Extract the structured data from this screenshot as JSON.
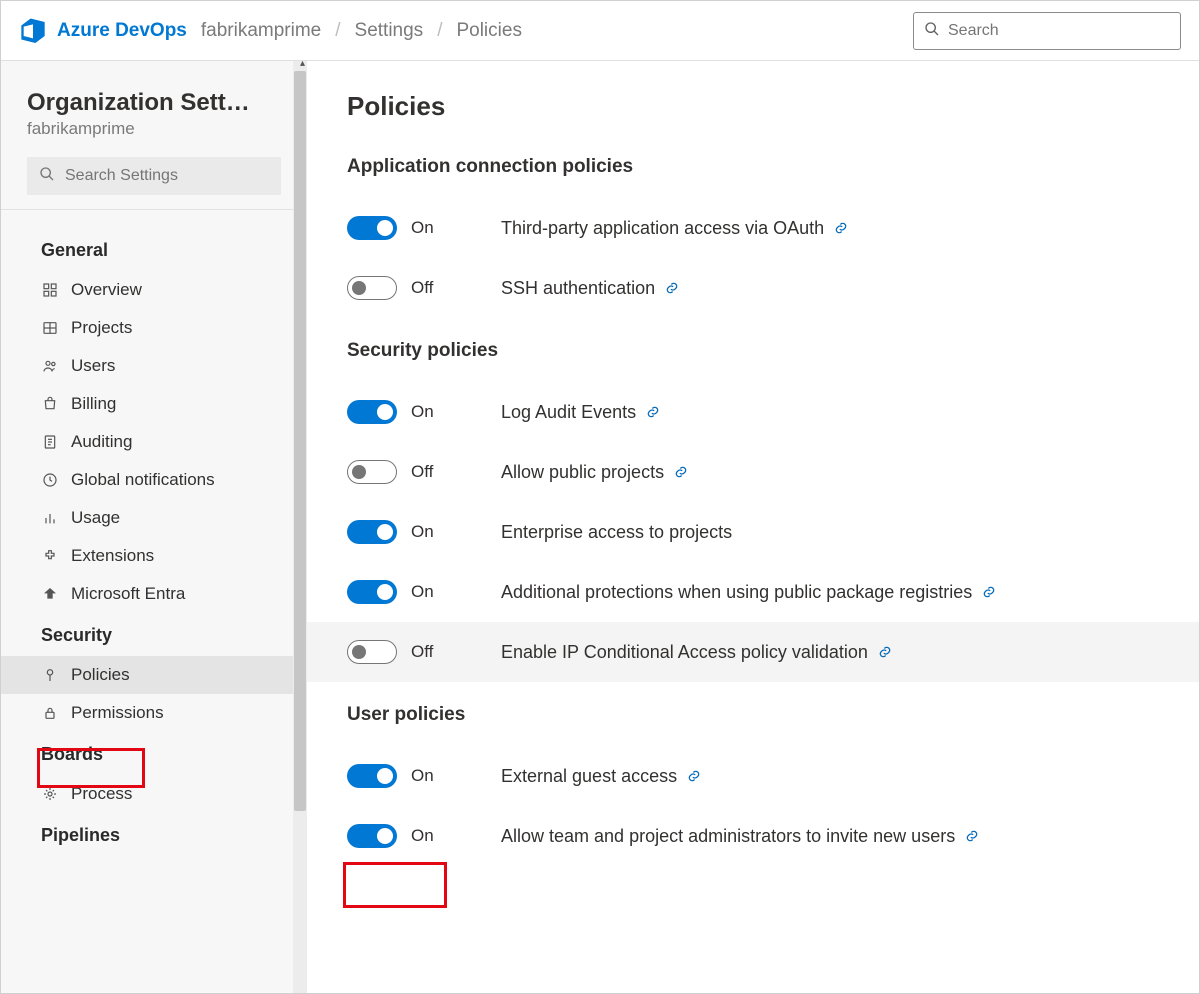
{
  "header": {
    "brand": "Azure DevOps",
    "search_placeholder": "Search"
  },
  "breadcrumb": {
    "items": [
      "fabrikamprime",
      "Settings",
      "Policies"
    ]
  },
  "sidebar": {
    "title": "Organization Settin...",
    "subtitle": "fabrikamprime",
    "search_placeholder": "Search Settings",
    "groups": [
      {
        "label": "General",
        "items": [
          {
            "icon": "overview",
            "label": "Overview"
          },
          {
            "icon": "projects",
            "label": "Projects"
          },
          {
            "icon": "users",
            "label": "Users"
          },
          {
            "icon": "billing",
            "label": "Billing"
          },
          {
            "icon": "auditing",
            "label": "Auditing"
          },
          {
            "icon": "notifications",
            "label": "Global notifications"
          },
          {
            "icon": "usage",
            "label": "Usage"
          },
          {
            "icon": "extensions",
            "label": "Extensions"
          },
          {
            "icon": "entra",
            "label": "Microsoft Entra"
          }
        ]
      },
      {
        "label": "Security",
        "items": [
          {
            "icon": "policies",
            "label": "Policies",
            "active": true
          },
          {
            "icon": "permissions",
            "label": "Permissions"
          }
        ]
      },
      {
        "label": "Boards",
        "items": [
          {
            "icon": "process",
            "label": "Process"
          }
        ]
      },
      {
        "label": "Pipelines",
        "items": []
      }
    ]
  },
  "main": {
    "title": "Policies",
    "sections": [
      {
        "title": "Application connection policies",
        "policies": [
          {
            "state_label": "On",
            "on": true,
            "label": "Third-party application access via OAuth",
            "has_link": true
          },
          {
            "state_label": "Off",
            "on": false,
            "label": "SSH authentication",
            "has_link": true
          }
        ]
      },
      {
        "title": "Security policies",
        "policies": [
          {
            "state_label": "On",
            "on": true,
            "label": "Log Audit Events",
            "has_link": true
          },
          {
            "state_label": "Off",
            "on": false,
            "label": "Allow public projects",
            "has_link": true
          },
          {
            "state_label": "On",
            "on": true,
            "label": "Enterprise access to projects",
            "has_link": false
          },
          {
            "state_label": "On",
            "on": true,
            "label": "Additional protections when using public package registries",
            "has_link": true
          },
          {
            "state_label": "Off",
            "on": false,
            "label": "Enable IP Conditional Access policy validation",
            "has_link": true,
            "hover": true
          }
        ]
      },
      {
        "title": "User policies",
        "policies": [
          {
            "state_label": "On",
            "on": true,
            "label": "External guest access",
            "has_link": true,
            "highlighted": true
          },
          {
            "state_label": "On",
            "on": true,
            "label": "Allow team and project administrators to invite new users",
            "has_link": true
          }
        ]
      }
    ]
  }
}
